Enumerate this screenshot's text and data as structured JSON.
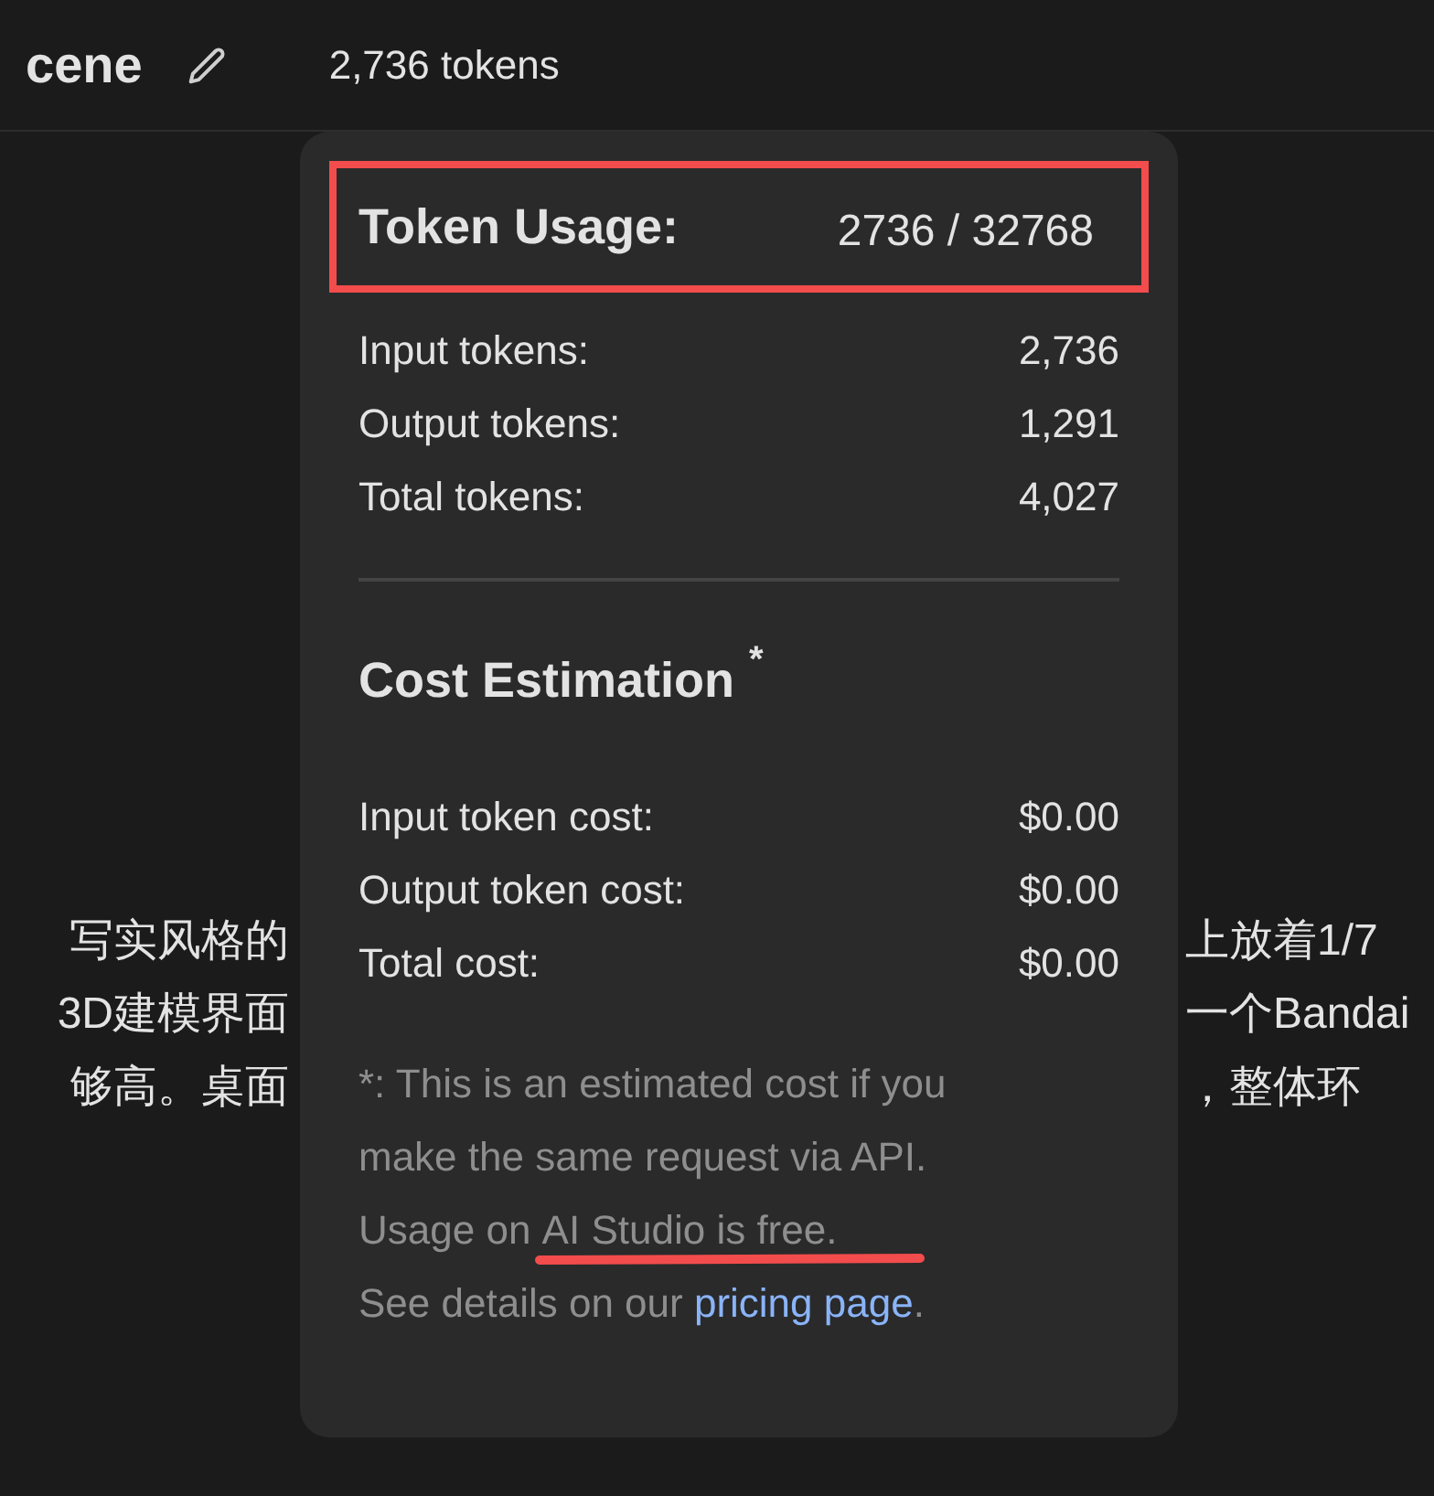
{
  "header": {
    "title": "cene",
    "token_count": "2,736 tokens"
  },
  "prompt_lines": [
    {
      "left": "写实风格的",
      "right": "上放着1/7"
    },
    {
      "left": "3D建模界面",
      "right": "一个Bandai"
    },
    {
      "left": "够高。桌面",
      "right": "，整体环"
    }
  ],
  "popup": {
    "title": "Token Usage:",
    "usage": "2736 / 32768",
    "token_rows": [
      {
        "label": "Input tokens:",
        "value": "2,736"
      },
      {
        "label": "Output tokens:",
        "value": "1,291"
      },
      {
        "label": "Total tokens:",
        "value": "4,027"
      }
    ],
    "cost_title": "Cost Estimation",
    "cost_mark": "*",
    "cost_rows": [
      {
        "label": "Input token cost:",
        "value": "$0.00"
      },
      {
        "label": "Output token cost:",
        "value": "$0.00"
      },
      {
        "label": "Total cost:",
        "value": "$0.00"
      }
    ],
    "note_lines": [
      "*: This is an estimated cost if you",
      "make the same request via API."
    ],
    "note_usage_prefix": "Usage on ",
    "note_usage_highlight": "AI Studio is free.",
    "note_details": "See details on our ",
    "link": "pricing page",
    "link_suffix": "."
  }
}
